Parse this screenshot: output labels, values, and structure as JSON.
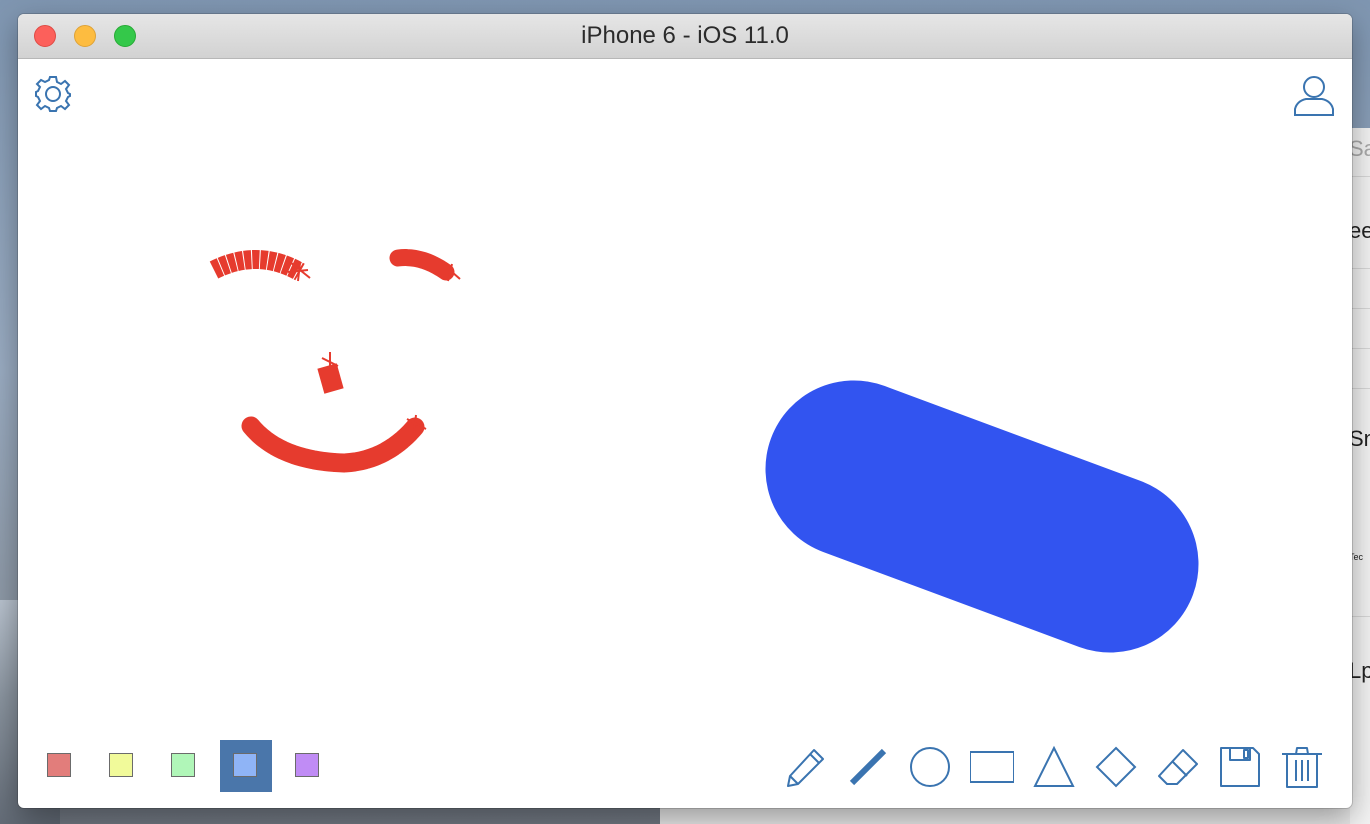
{
  "window": {
    "title": "iPhone 6 - iOS 11.0"
  },
  "colors": {
    "accent": "#3a74b0",
    "selected_swatch_bg": "#4a76aa",
    "drawing_red": "#e63b2e",
    "drawing_blue": "#3254f0"
  },
  "toolbar_top": {
    "settings_icon": "gear-icon",
    "profile_icon": "person-icon"
  },
  "palette": [
    {
      "name": "red",
      "color": "#e27d7b",
      "selected": false
    },
    {
      "name": "yellow",
      "color": "#f1fa9a",
      "selected": false
    },
    {
      "name": "green",
      "color": "#b0f6b8",
      "selected": false
    },
    {
      "name": "blue",
      "color": "#8fb4f6",
      "selected": true
    },
    {
      "name": "purple",
      "color": "#c08cf5",
      "selected": false
    }
  ],
  "tools": [
    {
      "name": "pencil",
      "icon": "pencil-icon"
    },
    {
      "name": "line",
      "icon": "line-icon"
    },
    {
      "name": "circle",
      "icon": "circle-icon"
    },
    {
      "name": "rectangle",
      "icon": "rectangle-icon"
    },
    {
      "name": "triangle",
      "icon": "triangle-icon"
    },
    {
      "name": "diamond",
      "icon": "diamond-icon"
    },
    {
      "name": "eraser",
      "icon": "eraser-icon"
    },
    {
      "name": "save",
      "icon": "save-icon"
    },
    {
      "name": "trash",
      "icon": "trash-icon"
    }
  ],
  "background_fragments": [
    "Sa",
    "ee",
    "Sn",
    "Tec",
    "Lp"
  ]
}
